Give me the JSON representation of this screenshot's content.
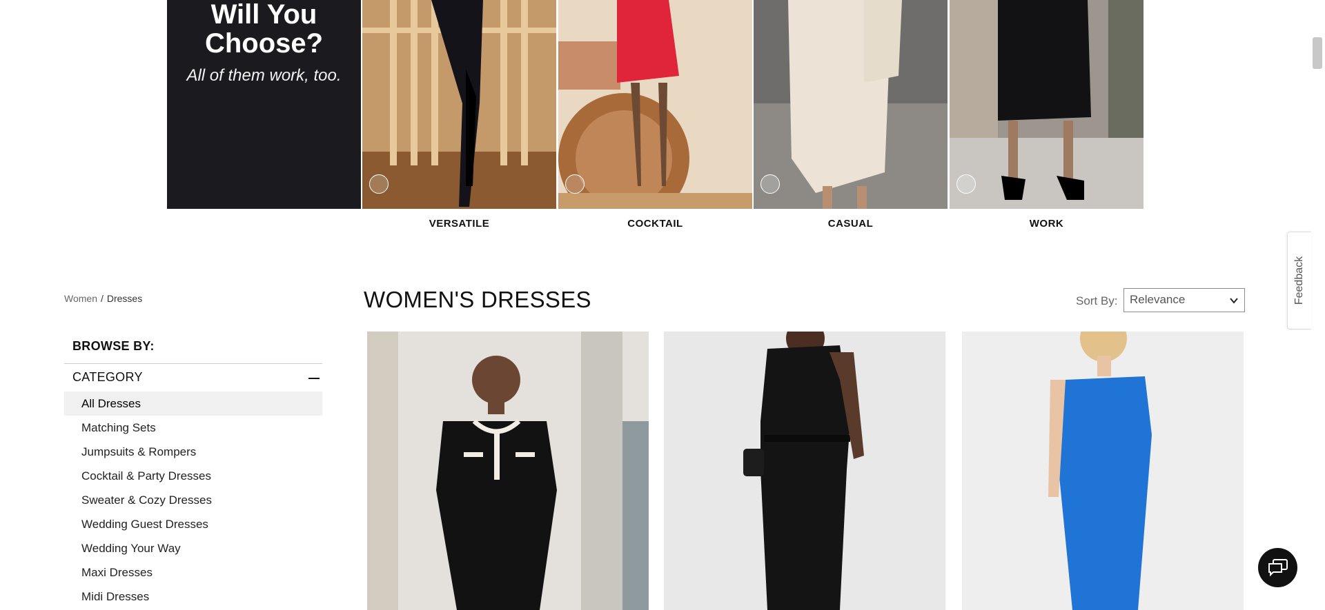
{
  "hero": {
    "promo_line1": "Will You",
    "promo_line2": "Choose?",
    "promo_line3": "All of them work, too.",
    "tiles": [
      {
        "label": "VERSATILE",
        "icon": "circle-select-icon"
      },
      {
        "label": "COCKTAIL",
        "icon": "circle-select-icon"
      },
      {
        "label": "CASUAL",
        "icon": "circle-select-icon"
      },
      {
        "label": "WORK",
        "icon": "circle-select-icon"
      }
    ]
  },
  "breadcrumb": {
    "items": [
      {
        "label": "Women"
      },
      {
        "label": "Dresses"
      }
    ],
    "separator": "/"
  },
  "page": {
    "title": "WOMEN'S DRESSES"
  },
  "sort": {
    "label": "Sort By:",
    "selected": "Relevance"
  },
  "sidebar": {
    "browse_by": "BROWSE BY:",
    "category_title": "CATEGORY",
    "categories": [
      "All Dresses",
      "Matching Sets",
      "Jumpsuits & Rompers",
      "Cocktail & Party Dresses",
      "Sweater & Cozy Dresses",
      "Wedding Guest Dresses",
      "Wedding Your Way",
      "Maxi Dresses",
      "Midi Dresses"
    ],
    "active_category": "All Dresses"
  },
  "products": [
    {
      "description_icon": "black-knit-dress-image"
    },
    {
      "description_icon": "black-jumpsuit-image"
    },
    {
      "description_icon": "blue-midi-dress-image"
    }
  ],
  "feedback": {
    "label": "Feedback"
  },
  "colors": {
    "promo_bg": "#1b1a1f",
    "blue_dress": "#1f74d6"
  }
}
